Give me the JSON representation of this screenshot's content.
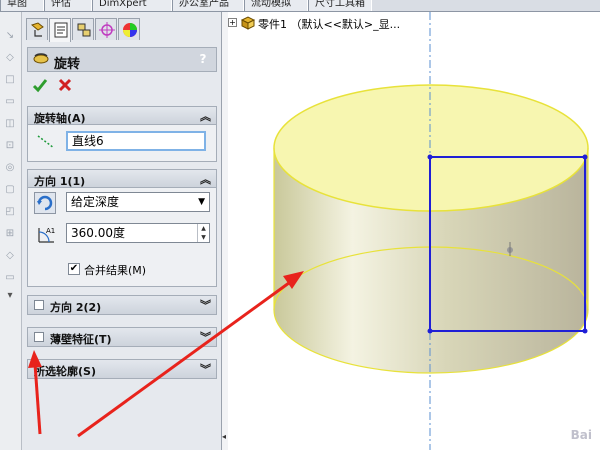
{
  "menu_tabs": [
    "草图",
    "评估",
    "DimXpert",
    "办公室产品",
    "流动模拟",
    "尺寸工具箱"
  ],
  "panel": {
    "feature_title": "旋转",
    "help": "?",
    "ok_label": "✔",
    "cancel_label": "✖",
    "axis_group": {
      "title": "旋转轴(A)",
      "value": "直线6"
    },
    "dir1_group": {
      "title": "方向 1(1)",
      "type_value": "给定深度",
      "angle_value": "360.00度",
      "merge_label": "合并结果(M)",
      "merge_checked": true
    },
    "dir2_group": {
      "title": "方向 2(2)"
    },
    "thin_group": {
      "title": "薄壁特征(T)"
    },
    "contour_group": {
      "title": "所选轮廓(S)"
    }
  },
  "tree": {
    "part_label": "零件1 （默认<<默认>_显..."
  },
  "colors": {
    "cylinder_fill": "#f7f6b0",
    "sketch_blue": "#1f1fd6",
    "arrow_red": "#e8231c",
    "axis_line": "#5a8fd0"
  },
  "watermark": "Bai"
}
